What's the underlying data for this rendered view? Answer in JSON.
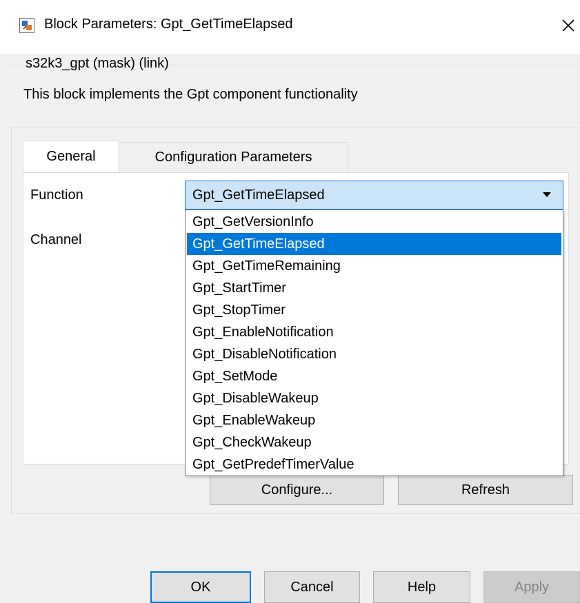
{
  "window": {
    "title": "Block Parameters: Gpt_GetTimeElapsed",
    "close_glyph": "✕"
  },
  "mask": {
    "legend": "s32k3_gpt (mask) (link)",
    "description": "This block implements the Gpt component functionality"
  },
  "tabs": [
    {
      "label": "General",
      "active": true
    },
    {
      "label": "Configuration Parameters",
      "active": false
    }
  ],
  "params": {
    "function_label": "Function",
    "channel_label": "Channel",
    "function_value": "Gpt_GetTimeElapsed"
  },
  "dropdown": {
    "options": [
      "Gpt_GetVersionInfo",
      "Gpt_GetTimeElapsed",
      "Gpt_GetTimeRemaining",
      "Gpt_StartTimer",
      "Gpt_StopTimer",
      "Gpt_EnableNotification",
      "Gpt_DisableNotification",
      "Gpt_SetMode",
      "Gpt_DisableWakeup",
      "Gpt_EnableWakeup",
      "Gpt_CheckWakeup",
      "Gpt_GetPredefTimerValue"
    ],
    "selected_index": 1
  },
  "buttons": {
    "configure": "Configure...",
    "refresh": "Refresh",
    "ok": "OK",
    "cancel": "Cancel",
    "help": "Help",
    "apply": "Apply"
  },
  "colors": {
    "accent": "#0078d7",
    "select_bg": "#cce4f7"
  }
}
